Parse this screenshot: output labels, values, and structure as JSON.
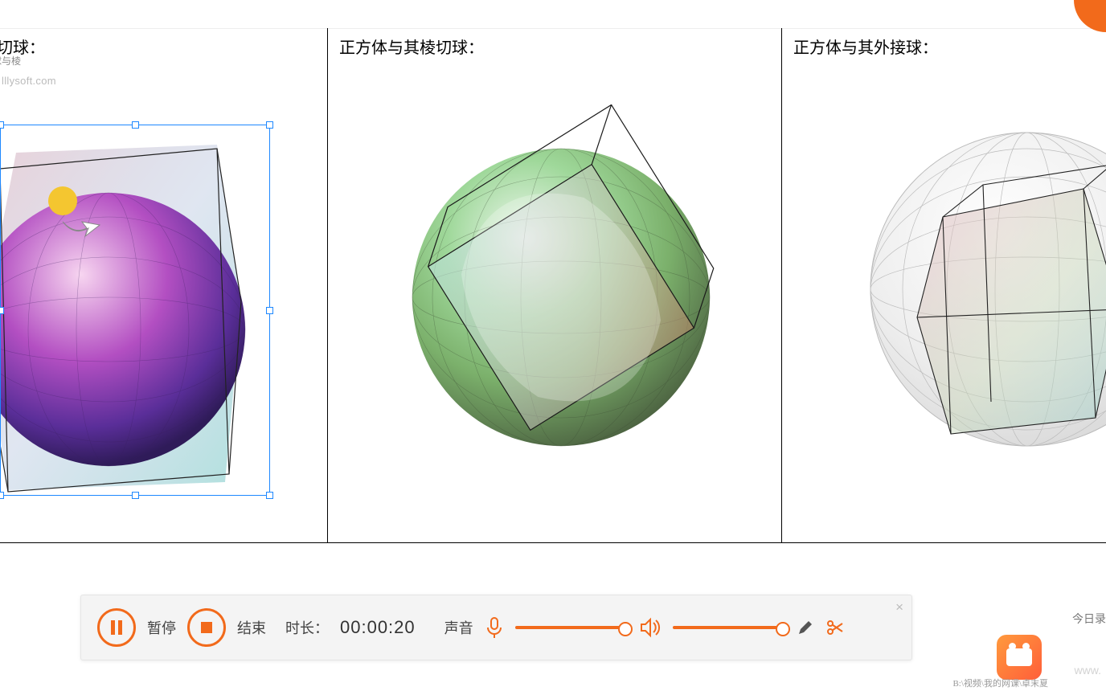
{
  "topbar": {},
  "panels": [
    {
      "title": "切球：",
      "watermark": "lllysoft.com",
      "crop_fragment": "球与棱"
    },
    {
      "title": "正方体与其棱切球："
    },
    {
      "title": "正方体与其外接球："
    }
  ],
  "recorder": {
    "pause_label": "暂停",
    "stop_label": "结束",
    "duration_label": "时长：",
    "duration_value": "00:00:20",
    "sound_label": "声音",
    "close_glyph": "×"
  },
  "footer": {
    "path": "B:\\视频\\我的网课\\卓末夏",
    "side_text": "今日录",
    "wm": "www."
  },
  "icons": {
    "mic": "mic-icon",
    "speaker": "speaker-icon",
    "pen": "pen-icon",
    "scissors": "scissors-icon",
    "pause": "pause-icon",
    "stop": "stop-icon"
  }
}
